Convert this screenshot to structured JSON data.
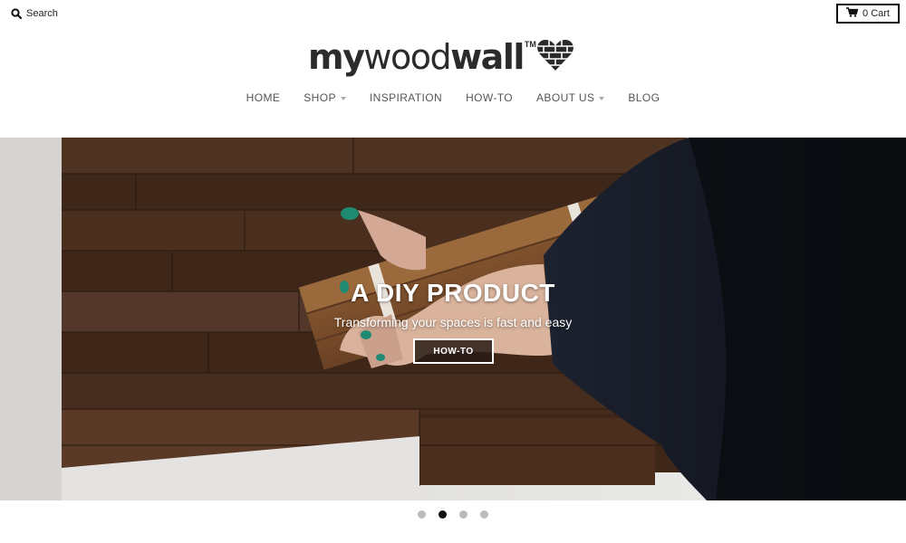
{
  "header": {
    "search_label": "Search",
    "cart_label": "0 Cart"
  },
  "logo": {
    "part1": "my",
    "part2": "wood",
    "part3": "wall",
    "trademark": "TM"
  },
  "nav": {
    "items": [
      {
        "label": "HOME",
        "has_dropdown": false
      },
      {
        "label": "SHOP",
        "has_dropdown": true
      },
      {
        "label": "INSPIRATION",
        "has_dropdown": false
      },
      {
        "label": "HOW-TO",
        "has_dropdown": false
      },
      {
        "label": "ABOUT US",
        "has_dropdown": true
      },
      {
        "label": "BLOG",
        "has_dropdown": false
      }
    ]
  },
  "hero": {
    "title": "A DIY PRODUCT",
    "subtitle": "Transforming your spaces is fast and easy",
    "button_label": "HOW-TO"
  },
  "slider": {
    "slide_count": 4,
    "active_slide": 2
  },
  "colors": {
    "text_dark": "#2b2b2b",
    "nav_text": "#555555",
    "dot_inactive": "#bbbbbb",
    "dot_active": "#111111",
    "wood_dark": "#4a2f1f",
    "sleeve": "#141820"
  }
}
